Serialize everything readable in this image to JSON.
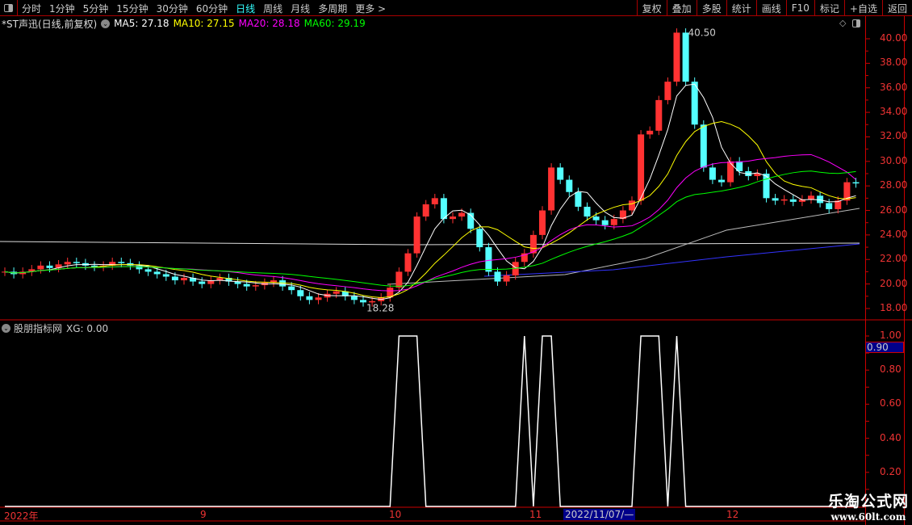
{
  "toolbar": {
    "periods": [
      "分时",
      "1分钟",
      "5分钟",
      "15分钟",
      "30分钟",
      "60分钟",
      "日线",
      "周线",
      "月线",
      "多周期",
      "更多 >"
    ],
    "active": "日线",
    "right_buttons": [
      "复权",
      "叠加",
      "多股",
      "统计",
      "画线",
      "F10",
      "标记",
      "+自选",
      "返回"
    ]
  },
  "info": {
    "title": "*ST声迅(日线,前复权)",
    "ma5": "MA5: 27.18",
    "ma10": "MA10: 27.15",
    "ma20": "MA20: 28.18",
    "ma60": "MA60: 29.19"
  },
  "sub": {
    "title": "股朋指标网",
    "xg": "XG: 0.00",
    "current": "0.90"
  },
  "dates": {
    "y": "2022年",
    "sep": "9",
    "oct": "10",
    "nov": "11",
    "dec": "12",
    "cursor": "2022/11/07/—"
  },
  "watermark": {
    "name": "乐淘公式网",
    "url": "www.60lt.com"
  },
  "colors": {
    "up": "#ff3232",
    "down": "#54ffff",
    "ma5": "#ffffff",
    "ma10": "#ffff00",
    "ma20": "#ff00ff",
    "ma60": "#00ff00",
    "axis": "#e33333"
  },
  "chart_data": {
    "type": "candlestick",
    "price_axis": [
      "40.00",
      "38.00",
      "36.00",
      "34.00",
      "32.00",
      "30.00",
      "28.00",
      "26.00",
      "24.00",
      "22.00",
      "20.00",
      "18.00"
    ],
    "ylim": [
      17.4,
      41
    ],
    "annotations": {
      "high": "40.50",
      "low": "18.28"
    },
    "closes": [
      21,
      20.8,
      21,
      21.2,
      21.5,
      21.3,
      21.6,
      21.8,
      21.7,
      21.5,
      21.4,
      21.5,
      21.8,
      21.7,
      21.5,
      21.2,
      21,
      20.8,
      20.6,
      20.3,
      20.5,
      20.2,
      20,
      20.3,
      20.5,
      20.2,
      20,
      19.8,
      19.9,
      20.1,
      20.3,
      19.8,
      19.5,
      19,
      18.7,
      18.9,
      19.2,
      19.4,
      19,
      18.7,
      18.5,
      18.6,
      18.9,
      19.7,
      21,
      22.5,
      25.5,
      26.5,
      27,
      25.3,
      25.5,
      25.8,
      24.5,
      23,
      21,
      20.2,
      20.7,
      21.8,
      22.5,
      24,
      26,
      29.5,
      28.5,
      27.5,
      26.3,
      25.5,
      25.2,
      24.8,
      25.3,
      26,
      26.8,
      32.2,
      32.5,
      35,
      36.5,
      40.5,
      36.5,
      33,
      29.5,
      28.5,
      28.3,
      30,
      29.2,
      28.8,
      29,
      27,
      26.8,
      26.9,
      26.7,
      26.9,
      27.2,
      26.6,
      26.1,
      26.8,
      28.3,
      28.2
    ],
    "xg_axis": [
      "1.00",
      "0.80",
      "0.60",
      "0.40",
      "0.20"
    ],
    "xg": [
      0,
      0,
      0,
      0,
      0,
      0,
      0,
      0,
      0,
      0,
      0,
      0,
      0,
      0,
      0,
      0,
      0,
      0,
      0,
      0,
      0,
      0,
      0,
      0,
      0,
      0,
      0,
      0,
      0,
      0,
      0,
      0,
      0,
      0,
      0,
      0,
      0,
      0,
      0,
      0,
      0,
      0,
      0,
      0,
      1,
      1,
      1,
      0,
      0,
      0,
      0,
      0,
      0,
      0,
      0,
      0,
      0,
      0,
      1,
      0,
      1,
      1,
      0,
      0,
      0,
      0,
      0,
      0,
      0,
      0,
      0,
      1,
      1,
      1,
      0,
      1,
      0,
      0,
      0,
      0,
      0,
      0,
      0,
      0,
      0,
      0,
      0,
      0,
      0,
      0,
      0,
      0,
      0,
      0,
      0,
      0
    ]
  }
}
